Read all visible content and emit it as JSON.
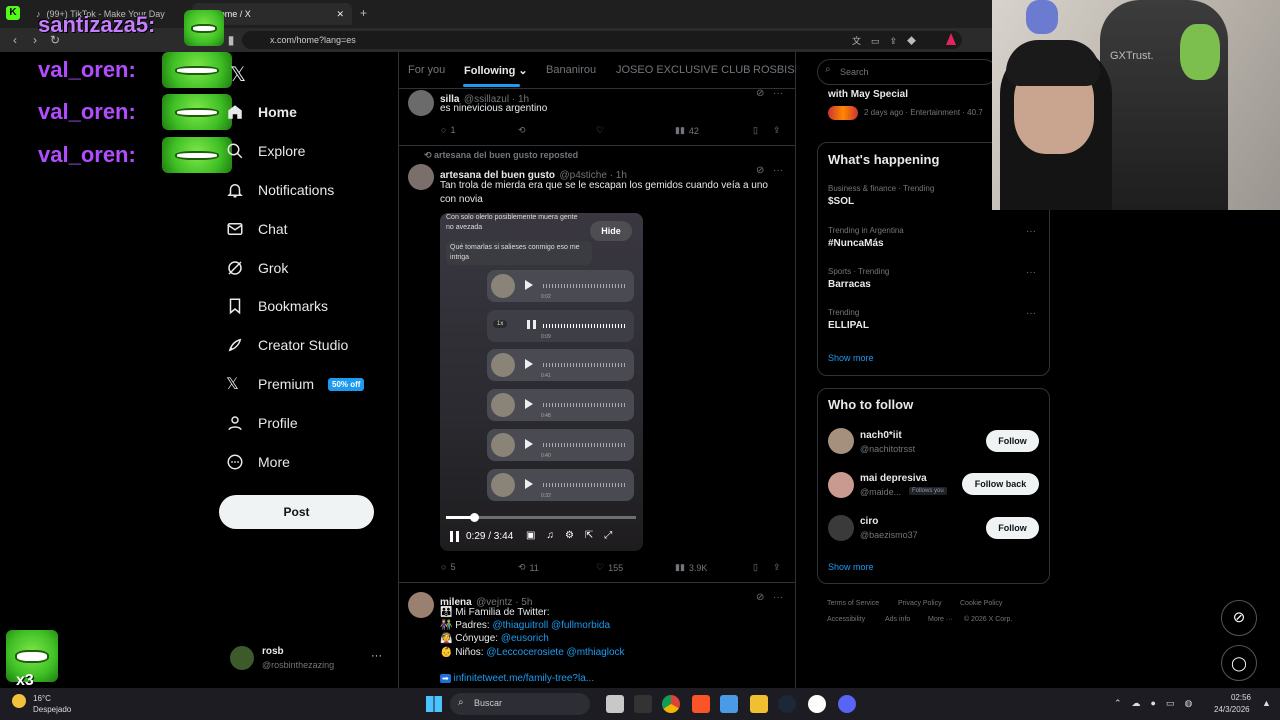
{
  "browser": {
    "tabs": [
      {
        "label": "(99+) TikTok - Make Your Day"
      },
      {
        "label": "Home / X"
      }
    ],
    "url": "x.com/home?lang=es"
  },
  "overlay": {
    "chat_lines": [
      {
        "user": "santizaza5:"
      },
      {
        "user": "val_oren:"
      },
      {
        "user": "val_oren:"
      },
      {
        "user": "val_oren:"
      }
    ],
    "combo": "x3"
  },
  "nav": {
    "items": [
      {
        "label": "Home"
      },
      {
        "label": "Explore"
      },
      {
        "label": "Notifications"
      },
      {
        "label": "Chat"
      },
      {
        "label": "Grok"
      },
      {
        "label": "Bookmarks"
      },
      {
        "label": "Creator Studio"
      },
      {
        "label": "Premium"
      },
      {
        "label": "Profile"
      },
      {
        "label": "More"
      }
    ],
    "premium_badge": "50% off",
    "post": "Post",
    "account": {
      "name": "rosb",
      "handle": "@rosbinthezazing"
    }
  },
  "timeline": {
    "tabs": [
      {
        "label": "For you"
      },
      {
        "label": "Following"
      },
      {
        "label": "Bananirou"
      },
      {
        "label": "JOSEO EXCLUSIVE CLUB"
      },
      {
        "label": "ROSBISIT"
      }
    ],
    "tweets": [
      {
        "name": "silla",
        "meta": "@ssillazul · 1h",
        "text": "es ninevicious argentino",
        "replies": "1",
        "reposts": "",
        "likes": "",
        "views": "42"
      },
      {
        "repost_by": "artesana del buen gusto reposted",
        "name": "artesana del buen gusto",
        "meta": "@p4stiche · 1h",
        "text": "Tan trola de mierda era que se le escapan los gemidos cuando veía a uno con novia",
        "replies": "5",
        "reposts": "11",
        "likes": "155",
        "views": "3.9K"
      },
      {
        "name": "milena",
        "meta": "@vejntz · 5h",
        "lines": [
          "Mi Familia de Twitter:",
          "Padres: ",
          "Cónyuge: ",
          "Niños: "
        ],
        "links": {
          "padres": "@thiaguitroll @fullmorbida",
          "conyuge": "@eusorich",
          "ninos": "@Leccocerosiete @mthiaglock",
          "url": "infinitetweet.me/family-tree?la..."
        }
      }
    ],
    "video": {
      "msg1": "Con solo olerlo posiblemente muera gente no avezada",
      "msg2": "Qué tomarlas si salieses conmigo eso me intriga",
      "hide": "Hide",
      "time": "0:29 / 3:44",
      "speed": "1x",
      "notes": [
        {
          "dur": "0:02"
        },
        {
          "dur": "0:09"
        },
        {
          "dur": "0:41"
        },
        {
          "dur": "0:48"
        },
        {
          "dur": "0:40"
        },
        {
          "dur": "0:32"
        }
      ]
    }
  },
  "right": {
    "search": "Search",
    "promo": {
      "title": "with May Special",
      "meta": "2 days ago · Entertainment · 40.7"
    },
    "whats_happening": {
      "title": "What's happening",
      "trends": [
        {
          "cat": "Business & finance · Trending",
          "name": "$SOL"
        },
        {
          "cat": "Trending in Argentina",
          "name": "#NuncaMás"
        },
        {
          "cat": "Sports · Trending",
          "name": "Barracas"
        },
        {
          "cat": "Trending",
          "name": "ELLIPAL"
        }
      ],
      "more": "Show more"
    },
    "who_to_follow": {
      "title": "Who to follow",
      "users": [
        {
          "name": "nach0*iit",
          "handle": "@nachitotrsst",
          "btn": "Follow",
          "badge": ""
        },
        {
          "name": "mai depresiva",
          "handle": "@maide...",
          "btn": "Follow back",
          "badge": "Follows you"
        },
        {
          "name": "ciro",
          "handle": "@baezismo37",
          "btn": "Follow",
          "badge": ""
        }
      ],
      "more": "Show more"
    },
    "footer": [
      "Terms of Service",
      "Privacy Policy",
      "Cookie Policy",
      "Accessibility",
      "Ads info",
      "More ···",
      "© 2026 X Corp."
    ]
  },
  "webcam": {
    "brand": "GXTrust."
  },
  "taskbar": {
    "weather_temp": "16°C",
    "weather_text": "Despejado",
    "search": "Buscar",
    "time": "02:56",
    "date": "24/3/2026"
  }
}
